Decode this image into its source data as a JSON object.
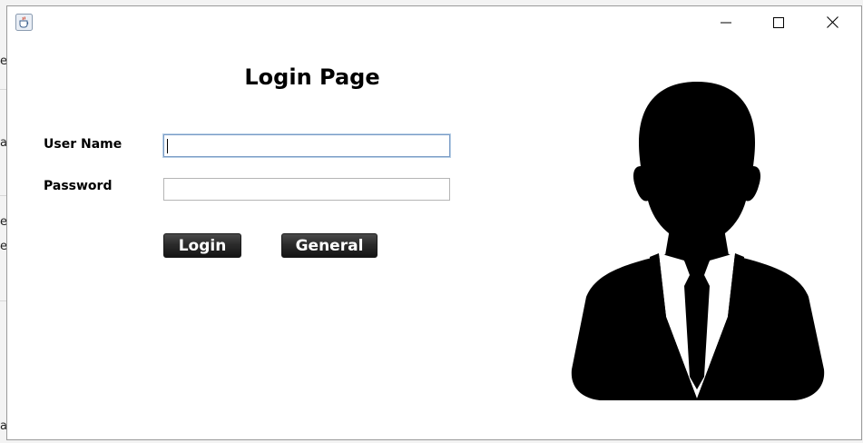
{
  "window": {
    "icon": "java-cup-icon",
    "controls": {
      "minimize": "minimize-icon",
      "maximize": "maximize-icon",
      "close": "close-icon"
    }
  },
  "form": {
    "title": "Login Page",
    "username_label": "User Name",
    "username_value": "",
    "password_label": "Password",
    "password_value": "",
    "login_button": "Login",
    "general_button": "General"
  },
  "avatar": {
    "icon": "user-silhouette-icon"
  },
  "background_fragments": [
    "e",
    "ab",
    "e",
    "e",
    "a"
  ],
  "colors": {
    "button_dark": "#2b2b2b",
    "focus_border": "#7a9cc6",
    "window_bg": "#ffffff"
  }
}
